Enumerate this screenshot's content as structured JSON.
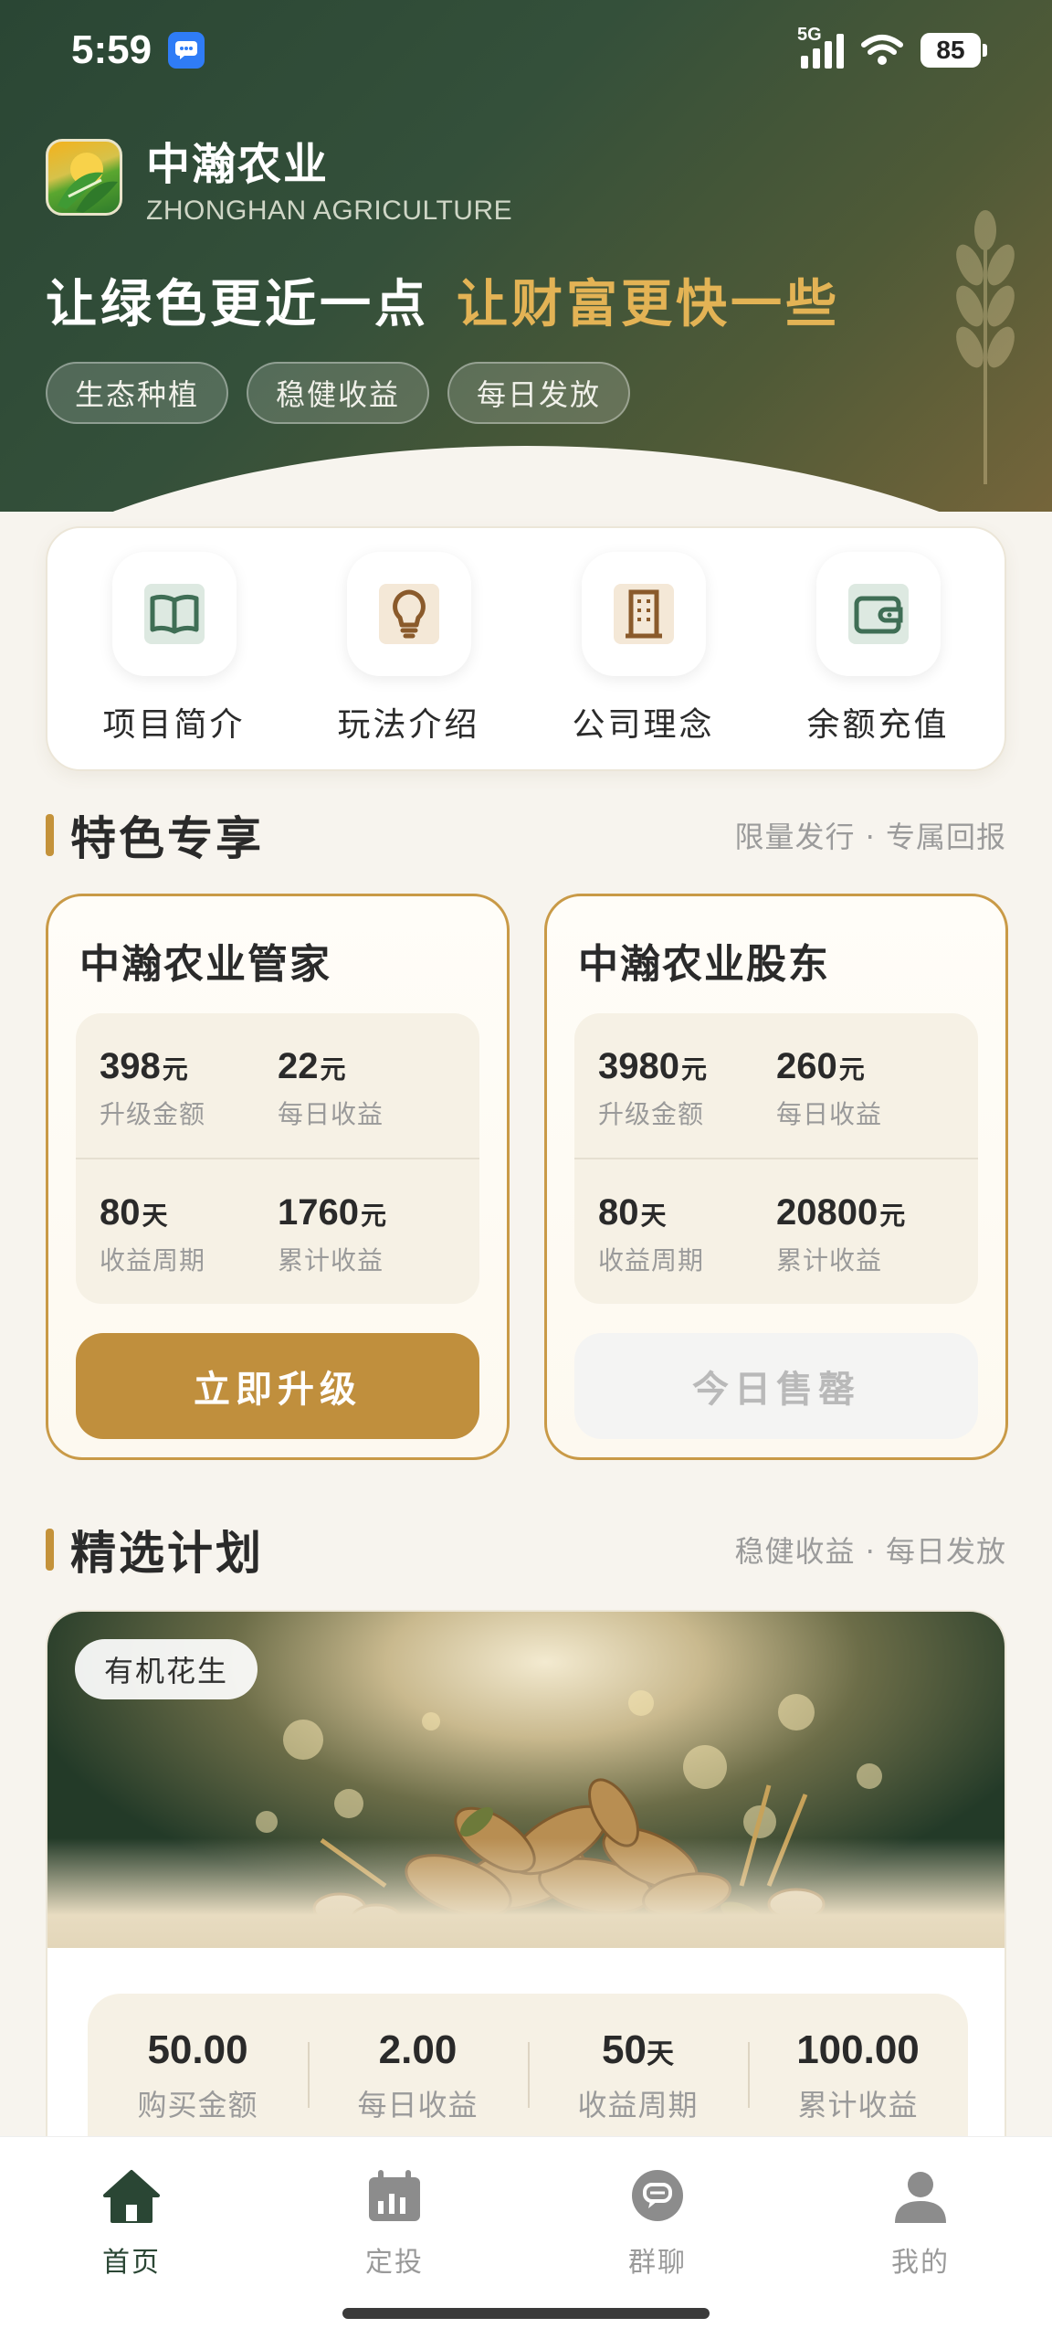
{
  "status_bar": {
    "time": "5:59",
    "network": "5G",
    "battery": "85"
  },
  "brand": {
    "name_cn": "中瀚农业",
    "name_en": "ZHONGHAN AGRICULTURE"
  },
  "slogan": {
    "part1": "让绿色更近一点",
    "part2": "让财富更快一些"
  },
  "tags": [
    "生态种植",
    "稳健收益",
    "每日发放"
  ],
  "quick_menu": [
    {
      "label": "项目简介",
      "icon": "book-icon",
      "color": "#3f6e55"
    },
    {
      "label": "玩法介绍",
      "icon": "lightbulb-icon",
      "color": "#8a5a2b"
    },
    {
      "label": "公司理念",
      "icon": "building-icon",
      "color": "#8a5a2b"
    },
    {
      "label": "余额充值",
      "icon": "wallet-icon",
      "color": "#3f6e55"
    }
  ],
  "featured": {
    "title": "特色专享",
    "subtitle": "限量发行 · 专属回报",
    "cards": [
      {
        "title": "中瀚农业管家",
        "upgrade_amount": {
          "value": "398",
          "unit": "元",
          "label": "升级金额"
        },
        "daily_income": {
          "value": "22",
          "unit": "元",
          "label": "每日收益"
        },
        "period": {
          "value": "80",
          "unit": "天",
          "label": "收益周期"
        },
        "total_income": {
          "value": "1760",
          "unit": "元",
          "label": "累计收益"
        },
        "button": "立即升级"
      },
      {
        "title": "中瀚农业股东",
        "upgrade_amount": {
          "value": "3980",
          "unit": "元",
          "label": "升级金额"
        },
        "daily_income": {
          "value": "260",
          "unit": "元",
          "label": "每日收益"
        },
        "period": {
          "value": "80",
          "unit": "天",
          "label": "收益周期"
        },
        "total_income": {
          "value": "20800",
          "unit": "元",
          "label": "累计收益"
        },
        "button": "今日售罄"
      }
    ]
  },
  "plans": {
    "title": "精选计划",
    "subtitle": "稳健收益 · 每日发放",
    "items": [
      {
        "tag": "有机花生",
        "buy_amount": {
          "value": "50.00",
          "label": "购买金额"
        },
        "daily_income": {
          "value": "2.00",
          "label": "每日收益"
        },
        "period": {
          "value": "50",
          "unit": "天",
          "label": "收益周期"
        },
        "total_income": {
          "value": "100.00",
          "label": "累计收益"
        }
      }
    ]
  },
  "bottom_nav": [
    {
      "label": "首页",
      "icon": "home-icon",
      "active": true
    },
    {
      "label": "定投",
      "icon": "calendar-chart-icon",
      "active": false
    },
    {
      "label": "群聊",
      "icon": "chat-icon",
      "active": false
    },
    {
      "label": "我的",
      "icon": "user-icon",
      "active": false
    }
  ],
  "colors": {
    "hero_green": "#2a4634",
    "gold": "#c08f3d",
    "accent_text": "#e3b355"
  }
}
